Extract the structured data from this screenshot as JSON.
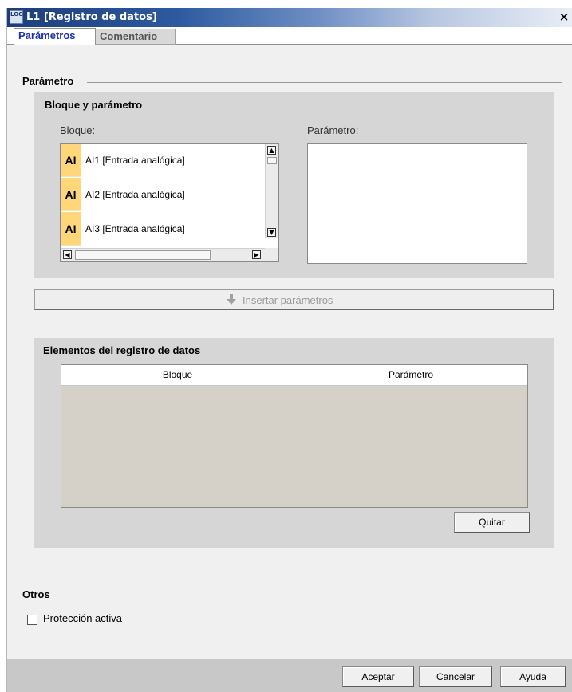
{
  "window": {
    "app_icon_text": "LOGO",
    "title": "L1 [Registro de datos]",
    "close_glyph": "×"
  },
  "tabs": [
    {
      "label": "Parámetros",
      "active": true
    },
    {
      "label": "Comentario",
      "active": false
    }
  ],
  "parametro_section": {
    "title": "Parámetro",
    "block_group": {
      "title": "Bloque y parámetro",
      "bloque_label": "Bloque:",
      "parametro_label": "Parámetro:",
      "bloque_items": [
        {
          "badge": "AI",
          "label": "AI1 [Entrada analógica]"
        },
        {
          "badge": "AI",
          "label": "AI2 [Entrada analógica]"
        },
        {
          "badge": "AI",
          "label": "AI3 [Entrada analógica]"
        }
      ],
      "parametro_items": []
    },
    "insert_button": {
      "label": "Insertar parámetros",
      "enabled": false,
      "icon": "arrow-down-icon"
    },
    "elements_group": {
      "title": "Elementos del registro de datos",
      "columns": [
        "Bloque",
        "Parámetro"
      ],
      "rows": [],
      "remove_button": "Quitar"
    }
  },
  "otros_section": {
    "title": "Otros",
    "protection_checkbox": {
      "label": "Protección activa",
      "checked": false
    }
  },
  "footer": {
    "ok": "Aceptar",
    "cancel": "Cancelar",
    "help": "Ayuda"
  },
  "colors": {
    "title_bar_start": "#1d3d7a",
    "active_tab_text": "#1a2fb0",
    "badge_bg": "#ffd77a",
    "group_bg": "#d6d6d6",
    "table_bg": "#d5d1c9"
  }
}
